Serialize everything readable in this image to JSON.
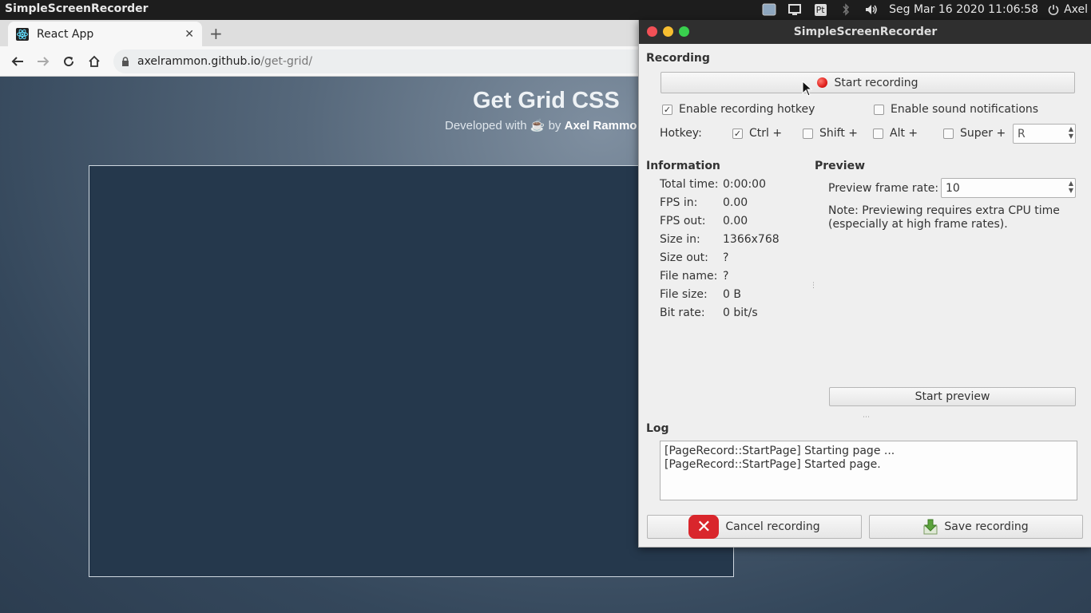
{
  "topbar": {
    "app_name": "SimpleScreenRecorder",
    "datetime": "Seg Mar 16 2020 11:06:58",
    "user": "Axel",
    "keyboard_layout": "Pt"
  },
  "browser": {
    "tab_title": "React App",
    "url_host": "axelrammon.github.io",
    "url_path": "/get-grid/"
  },
  "page": {
    "title": "Get Grid CSS",
    "subtitle_prefix": "Developed with",
    "subtitle_by": "by",
    "author": "Axel Rammo"
  },
  "dialog": {
    "window_title": "SimpleScreenRecorder",
    "recording": {
      "heading": "Recording",
      "start_button": "Start recording",
      "enable_hotkey": "Enable recording hotkey",
      "enable_hotkey_checked": true,
      "enable_sound": "Enable sound notifications",
      "enable_sound_checked": false,
      "hotkey_label": "Hotkey:",
      "ctrl": "Ctrl +",
      "ctrl_checked": true,
      "shift": "Shift +",
      "shift_checked": false,
      "alt": "Alt +",
      "alt_checked": false,
      "super": "Super +",
      "super_checked": false,
      "key_value": "R"
    },
    "information": {
      "heading": "Information",
      "rows": [
        {
          "label": "Total time:",
          "value": "0:00:00"
        },
        {
          "label": "FPS in:",
          "value": "0.00"
        },
        {
          "label": "FPS out:",
          "value": "0.00"
        },
        {
          "label": "Size in:",
          "value": "1366x768"
        },
        {
          "label": "Size out:",
          "value": "?"
        },
        {
          "label": "File name:",
          "value": "?"
        },
        {
          "label": "File size:",
          "value": "0 B"
        },
        {
          "label": "Bit rate:",
          "value": "0 bit/s"
        }
      ]
    },
    "preview": {
      "heading": "Preview",
      "frame_rate_label": "Preview frame rate:",
      "frame_rate_value": "10",
      "note_line1": "Note: Previewing requires extra CPU time",
      "note_line2": "(especially at high frame rates).",
      "start_button": "Start preview"
    },
    "log": {
      "heading": "Log",
      "lines": [
        "[PageRecord::StartPage] Starting page ...",
        "[PageRecord::StartPage] Started page."
      ]
    },
    "cancel_button": "Cancel recording",
    "save_button": "Save recording"
  },
  "colors": {
    "record_dot": "#e0201d",
    "cancel_icon_bg": "#d9262c",
    "save_icon": "#5aa33b"
  }
}
